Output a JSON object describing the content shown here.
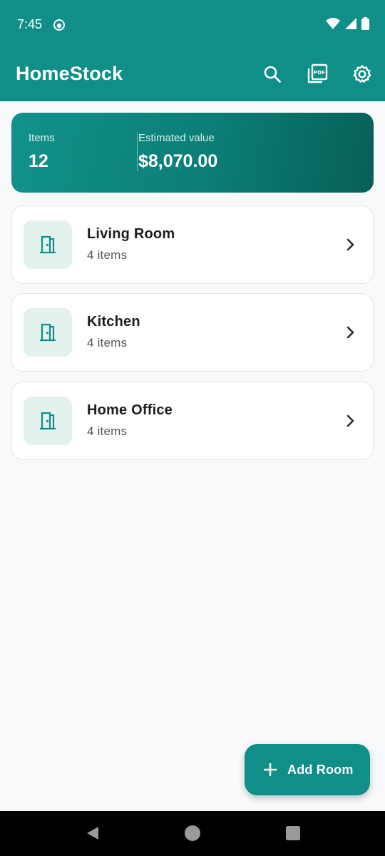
{
  "status_bar": {
    "time": "7:45"
  },
  "app_bar": {
    "title": "HomeStock",
    "actions": [
      "search-icon",
      "pdf-export-icon",
      "settings-icon"
    ]
  },
  "summary": {
    "items_label": "Items",
    "items_value": "12",
    "value_label": "Estimated value",
    "value_amount": "$8,070.00"
  },
  "rooms": [
    {
      "name": "Living Room",
      "count": "4 items",
      "icon": "door-icon"
    },
    {
      "name": "Kitchen",
      "count": "4 items",
      "icon": "door-icon"
    },
    {
      "name": "Home Office",
      "count": "4 items",
      "icon": "door-icon"
    }
  ],
  "fab": {
    "label": "Add Room",
    "icon": "plus-icon"
  },
  "colors": {
    "primary": "#0f8f87",
    "icon_tint": "#0f8f87",
    "icon_bg": "#e3f2ef",
    "background": "#f7f9fb"
  }
}
